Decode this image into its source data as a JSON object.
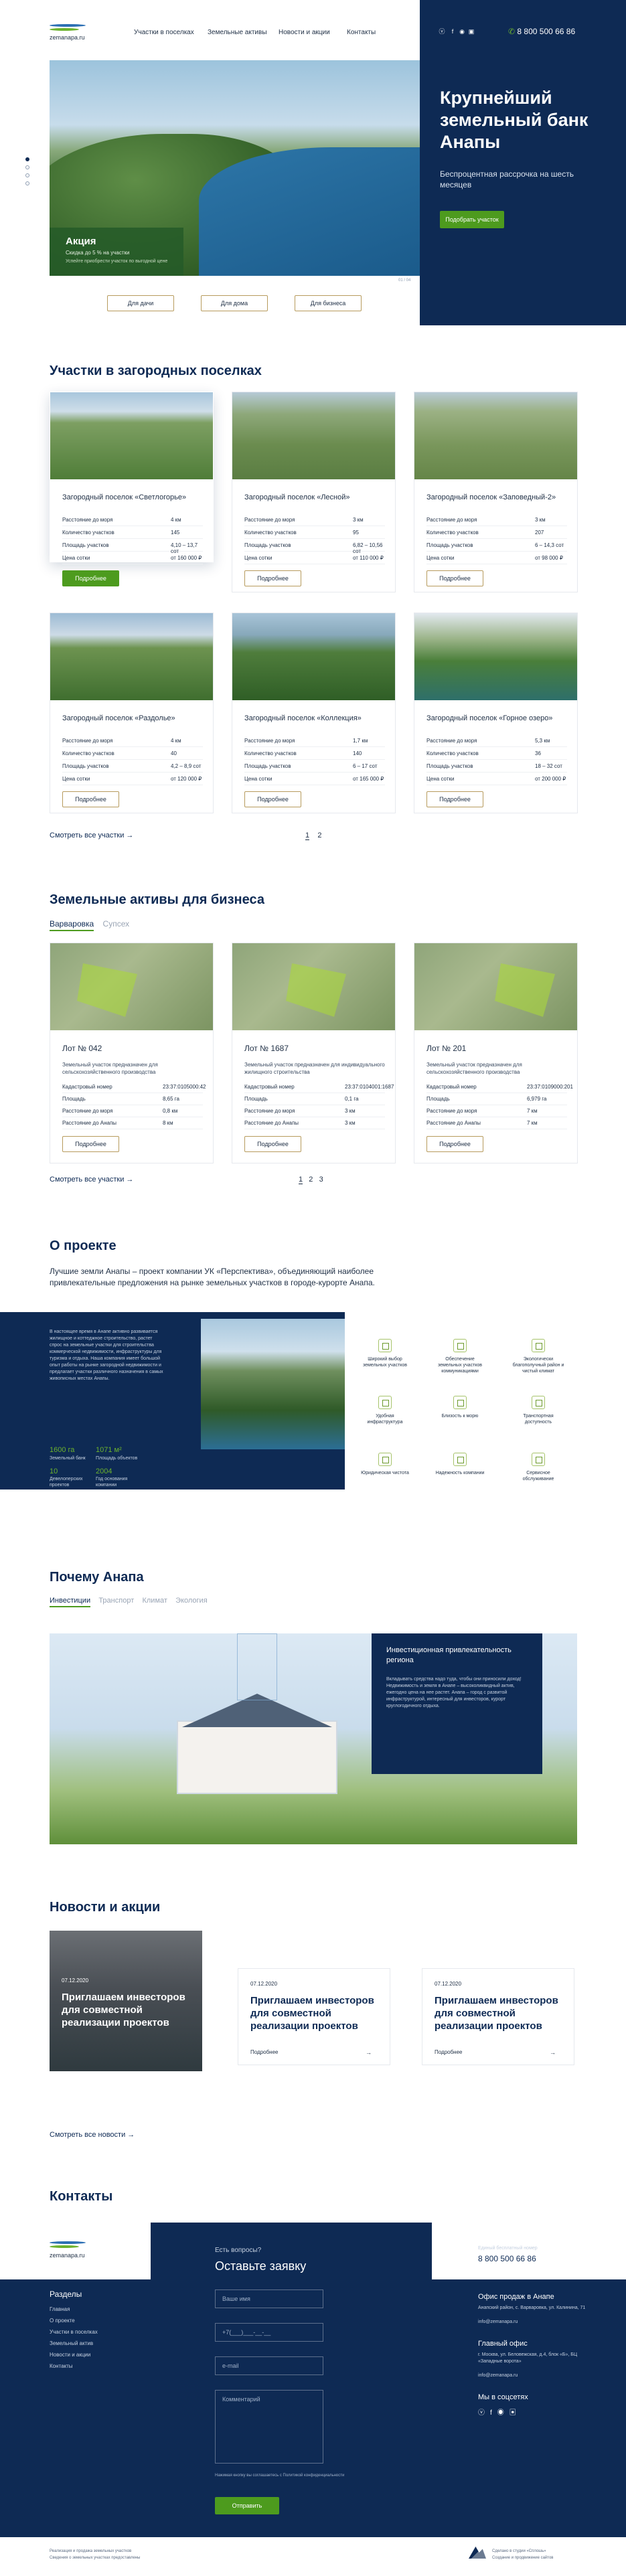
{
  "header": {
    "logo_text": "zemanapa.ru",
    "nav": [
      "Участки в поселках",
      "Земельные активы",
      "Новости и акции",
      "Контакты"
    ],
    "phone": "8 800 500 66 86",
    "social_icons": [
      "vk-icon",
      "facebook-icon",
      "ok-icon",
      "instagram-icon"
    ]
  },
  "hero": {
    "title": "Крупнейший земельный банк Анапы",
    "subtitle": "Беспроцентная рассрочка на шесть месяцев",
    "cta": "Подобрать участок",
    "promo_title": "Акция",
    "promo_sub": "Скидка до 5 % на участки",
    "promo_note": "Успейте приобрести участок по выгодной цене",
    "counter": "01 / 04",
    "buttons": [
      "Для дачи",
      "Для дома",
      "Для бизнеса"
    ]
  },
  "plots": {
    "title": "Участки в загородных поселках",
    "row_labels": [
      "Расстояние до моря",
      "Количество участков",
      "Площадь участков",
      "Цена сотки"
    ],
    "details_label": "Подробнее",
    "items": [
      {
        "name": "Загородный поселок «Светлогорье»",
        "values": [
          "4 км",
          "145",
          "4,10 – 13,7 сот",
          "от 160 000 ₽"
        ]
      },
      {
        "name": "Загородный поселок «Лесной»",
        "values": [
          "3 км",
          "95",
          "6,82 – 10,56 сот",
          "от 110 000 ₽"
        ]
      },
      {
        "name": "Загородный поселок «Заповедный-2»",
        "values": [
          "3 км",
          "207",
          "6 – 14,3 сот",
          "от 98 000 ₽"
        ]
      },
      {
        "name": "Загородный поселок «Раздолье»",
        "values": [
          "4 км",
          "40",
          "4,2 – 8,9 сот",
          "от 120 000 ₽"
        ]
      },
      {
        "name": "Загородный поселок «Коллекция»",
        "values": [
          "1,7 км",
          "140",
          "6 – 17 сот",
          "от 165 000 ₽"
        ]
      },
      {
        "name": "Загородный поселок «Горное озеро»",
        "values": [
          "5,3 км",
          "36",
          "18 – 32 сот",
          "от 200 000 ₽"
        ]
      }
    ],
    "more": "Смотреть все участки →",
    "pages": [
      "1",
      "2"
    ]
  },
  "business": {
    "title": "Земельные активы для бизнеса",
    "tabs": [
      "Варваровка",
      "Супсех"
    ],
    "row_labels": [
      "Кадастровый номер",
      "Площадь",
      "Расстояние до моря",
      "Расстояние до Анапы"
    ],
    "details_label": "Подробнее",
    "items": [
      {
        "name": "Лот № 042",
        "desc": "Земельный участок предназначен для сельскохозяйственного производства",
        "values": [
          "23:37:0105000:42",
          "8,65 га",
          "0,8 км",
          "8 км"
        ]
      },
      {
        "name": "Лот № 1687",
        "desc": "Земельный участок предназначен для индивидуального жилищного строительства",
        "values": [
          "23:37:0104001:1687",
          "0,1 га",
          "3 км",
          "3 км"
        ]
      },
      {
        "name": "Лот № 201",
        "desc": "Земельный участок предназначен для сельскохозяйственного производства",
        "values": [
          "23:37:0109000:201",
          "6,979 га",
          "7 км",
          "7 км"
        ]
      }
    ],
    "more": "Смотреть все участки →",
    "pages": [
      "1",
      "2",
      "3"
    ]
  },
  "about": {
    "title": "О проекте",
    "lead": "Лучшие земли Анапы – проект компании УК «Перспектива», объединяющий наиболее привлекательные предложения на рынке земельных участков в городе-курорте Анапа.",
    "band_text": "В настоящее время в Анапе активно развивается жилищное и коттеджное строительство, растет спрос на земельные участки для строительства коммерческой недвижимости, инфраструктуры для туризма и отдыха. Наша компания имеет большой опыт работы на рынке загородной недвижимости и предлагает участки различного назначения в самых живописных местах Анапы.",
    "stats": [
      {
        "value": "1600 га",
        "label": "Земельный банк"
      },
      {
        "value": "1071 м²",
        "label": "Площадь объектов"
      },
      {
        "value": "10",
        "label": "Девелоперских проектов"
      },
      {
        "value": "2004",
        "label": "Год основания компании"
      }
    ],
    "features": [
      "Широкий выбор земельных участков",
      "Обеспечение земельных участков коммуникациями",
      "Экологически благополучный район и чистый климат",
      "Удобная инфраструктура",
      "Близость к морю",
      "Транспортная доступность",
      "Юридическая чистота",
      "Надежность компании",
      "Сервисное обслуживание"
    ]
  },
  "why": {
    "title": "Почему Анапа",
    "tabs": [
      "Инвестиции",
      "Транспорт",
      "Климат",
      "Экология"
    ],
    "box_title": "Инвестиционная привлекательность региона",
    "box_text": "Вкладывать средства надо туда, чтобы они приносили доход! Недвижимость и земля в Анапе – высоколиквидный актив, ежегодно цена на нее растет. Анапа – город с развитой инфраструктурой, интересный для инвесторов, курорт круглогодичного отдыха."
  },
  "news": {
    "title": "Новости и акции",
    "items": [
      {
        "date": "07.12.2020",
        "title": "Приглашаем инвесторов для совместной реализации проектов"
      },
      {
        "date": "07.12.2020",
        "title": "Приглашаем инвесторов для совместной реализации проектов",
        "more": "Подробнее"
      },
      {
        "date": "07.12.2020",
        "title": "Приглашаем инвесторов для совместной реализации проектов",
        "more": "Подробнее"
      }
    ],
    "more": "Смотреть все новости →"
  },
  "contacts": {
    "title": "Контакты",
    "logo_text": "zemanapa.ru",
    "menu_title": "Разделы",
    "menu": [
      "Главная",
      "О проекте",
      "Участки в поселках",
      "Земельный актив",
      "Новости и акции",
      "Контакты"
    ],
    "form_q": "Есть вопросы?",
    "form_title": "Оставьте заявку",
    "fields": [
      "Ваше имя",
      "+7(___)___-__-__",
      "e-mail",
      "Комментарий"
    ],
    "consent": "Нажимая кнопку вы соглашаетесь с Политикой конфиденциальности",
    "submit": "Отправить",
    "hotline_label": "Единый бесплатный номер",
    "hotline": "8 800 500 66 86",
    "office_title": "Офис продаж в Анапе",
    "office_addr": "Анапский район, с. Варваровка, ул. Калинина, 71",
    "office_email": "info@zemanapa.ru",
    "main_title": "Главный офис",
    "main_addr": "г. Москва, ул. Беловежская, д.4, блок «Б», БЦ «Западные ворота»",
    "main_email": "info@zemanapa.ru",
    "social_title": "Мы в соцсетях",
    "copy1": "Реализация и продажа земельных участков",
    "copy2": "Сведения о земельных участках предоставлены",
    "dev1": "Сделано в студии «Сплошь»",
    "dev2": "Создание и продвижение сайтов"
  }
}
